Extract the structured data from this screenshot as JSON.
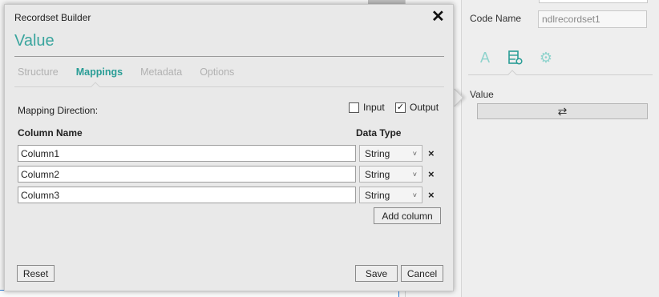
{
  "dialog": {
    "title": "Recordset Builder",
    "heading": "Value",
    "close_icon": "close-icon",
    "tabs": [
      {
        "label": "Structure",
        "active": false
      },
      {
        "label": "Mappings",
        "active": true
      },
      {
        "label": "Metadata",
        "active": false
      },
      {
        "label": "Options",
        "active": false
      }
    ],
    "mapping_direction_label": "Mapping Direction:",
    "input_option": {
      "label": "Input",
      "checked": false
    },
    "output_option": {
      "label": "Output",
      "checked": true,
      "check_glyph": "✓"
    },
    "column_name_header": "Column Name",
    "data_type_header": "Data Type",
    "rows": [
      {
        "name": "Column1",
        "type": "String",
        "remove": "×"
      },
      {
        "name": "Column2",
        "type": "String",
        "remove": "×"
      },
      {
        "name": "Column3",
        "type": "String",
        "remove": "×"
      }
    ],
    "select_chevron": "˅",
    "add_column_label": "Add column",
    "reset_label": "Reset",
    "save_label": "Save",
    "cancel_label": "Cancel"
  },
  "right_panel": {
    "code_name_label": "Code Name",
    "code_name_value": "ndlrecordset1",
    "icons": [
      "text-icon",
      "recordset-settings-icon",
      "gear-icon"
    ],
    "icon_glyphs": {
      "text": "A",
      "gear": "⚙"
    },
    "value_label": "Value",
    "value_button_glyph": "⇄"
  },
  "colors": {
    "accent": "#3aa59e",
    "accent_light": "#8fd3cd",
    "panel_bg": "#eeeeee",
    "dialog_bg": "#e9e9e9"
  }
}
